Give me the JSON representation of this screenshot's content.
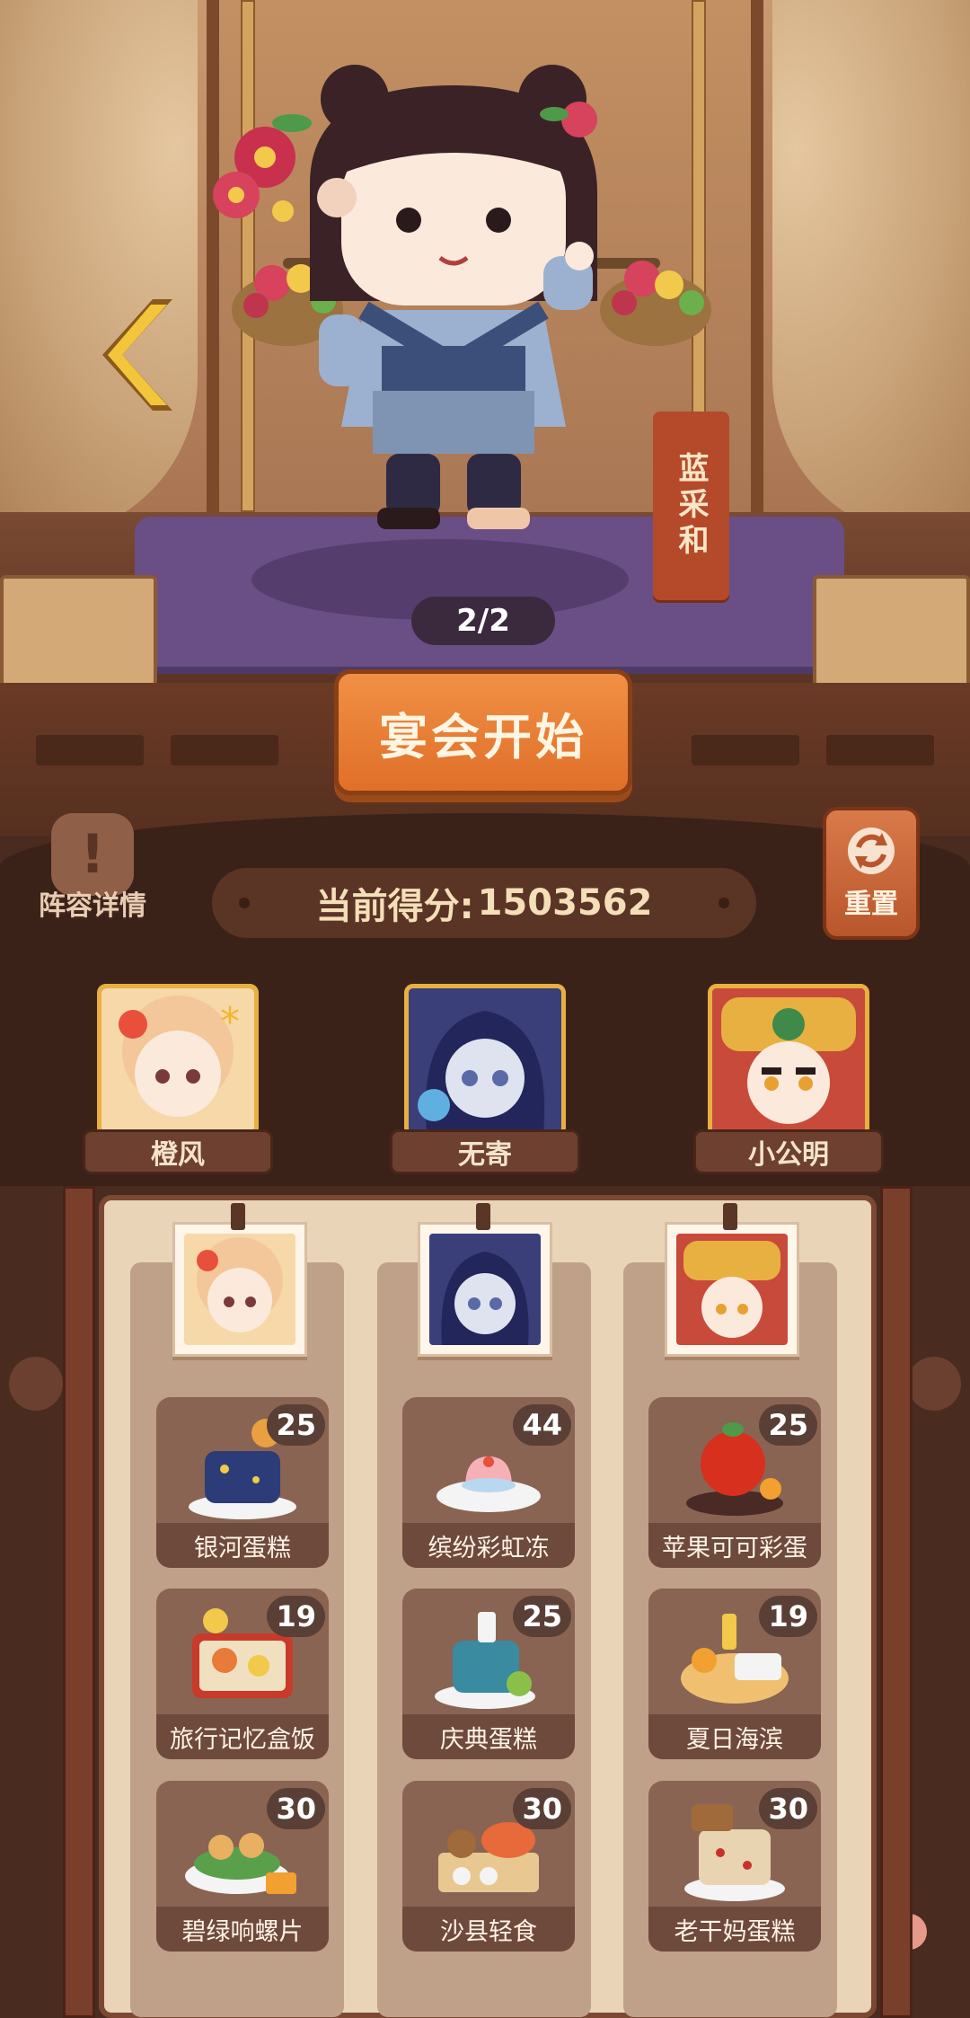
{
  "stage": {
    "character_name": "蓝采和",
    "page_indicator": "2/2"
  },
  "actions": {
    "start_label": "宴会开始",
    "detail_label": "阵容详情",
    "reset_label": "重置"
  },
  "score": {
    "label": "当前得分:",
    "value": "1503562"
  },
  "team": [
    {
      "name": "橙风"
    },
    {
      "name": "无寄"
    },
    {
      "name": "小公明"
    }
  ],
  "columns": [
    {
      "dishes": [
        {
          "name": "银河蛋糕",
          "count": "25"
        },
        {
          "name": "旅行记忆盒饭",
          "count": "19"
        },
        {
          "name": "碧绿响螺片",
          "count": "30"
        }
      ]
    },
    {
      "dishes": [
        {
          "name": "缤纷彩虹冻",
          "count": "44"
        },
        {
          "name": "庆典蛋糕",
          "count": "25"
        },
        {
          "name": "沙县轻食",
          "count": "30"
        }
      ]
    },
    {
      "dishes": [
        {
          "name": "苹果可可彩蛋",
          "count": "25"
        },
        {
          "name": "夏日海滨",
          "count": "19"
        },
        {
          "name": "老干妈蛋糕",
          "count": "30"
        }
      ]
    }
  ],
  "colors": {
    "accent_orange": "#e77b32",
    "frame_gold": "#e8b040",
    "banner_red": "#b44a2a",
    "rug_purple": "#6a4f86"
  }
}
